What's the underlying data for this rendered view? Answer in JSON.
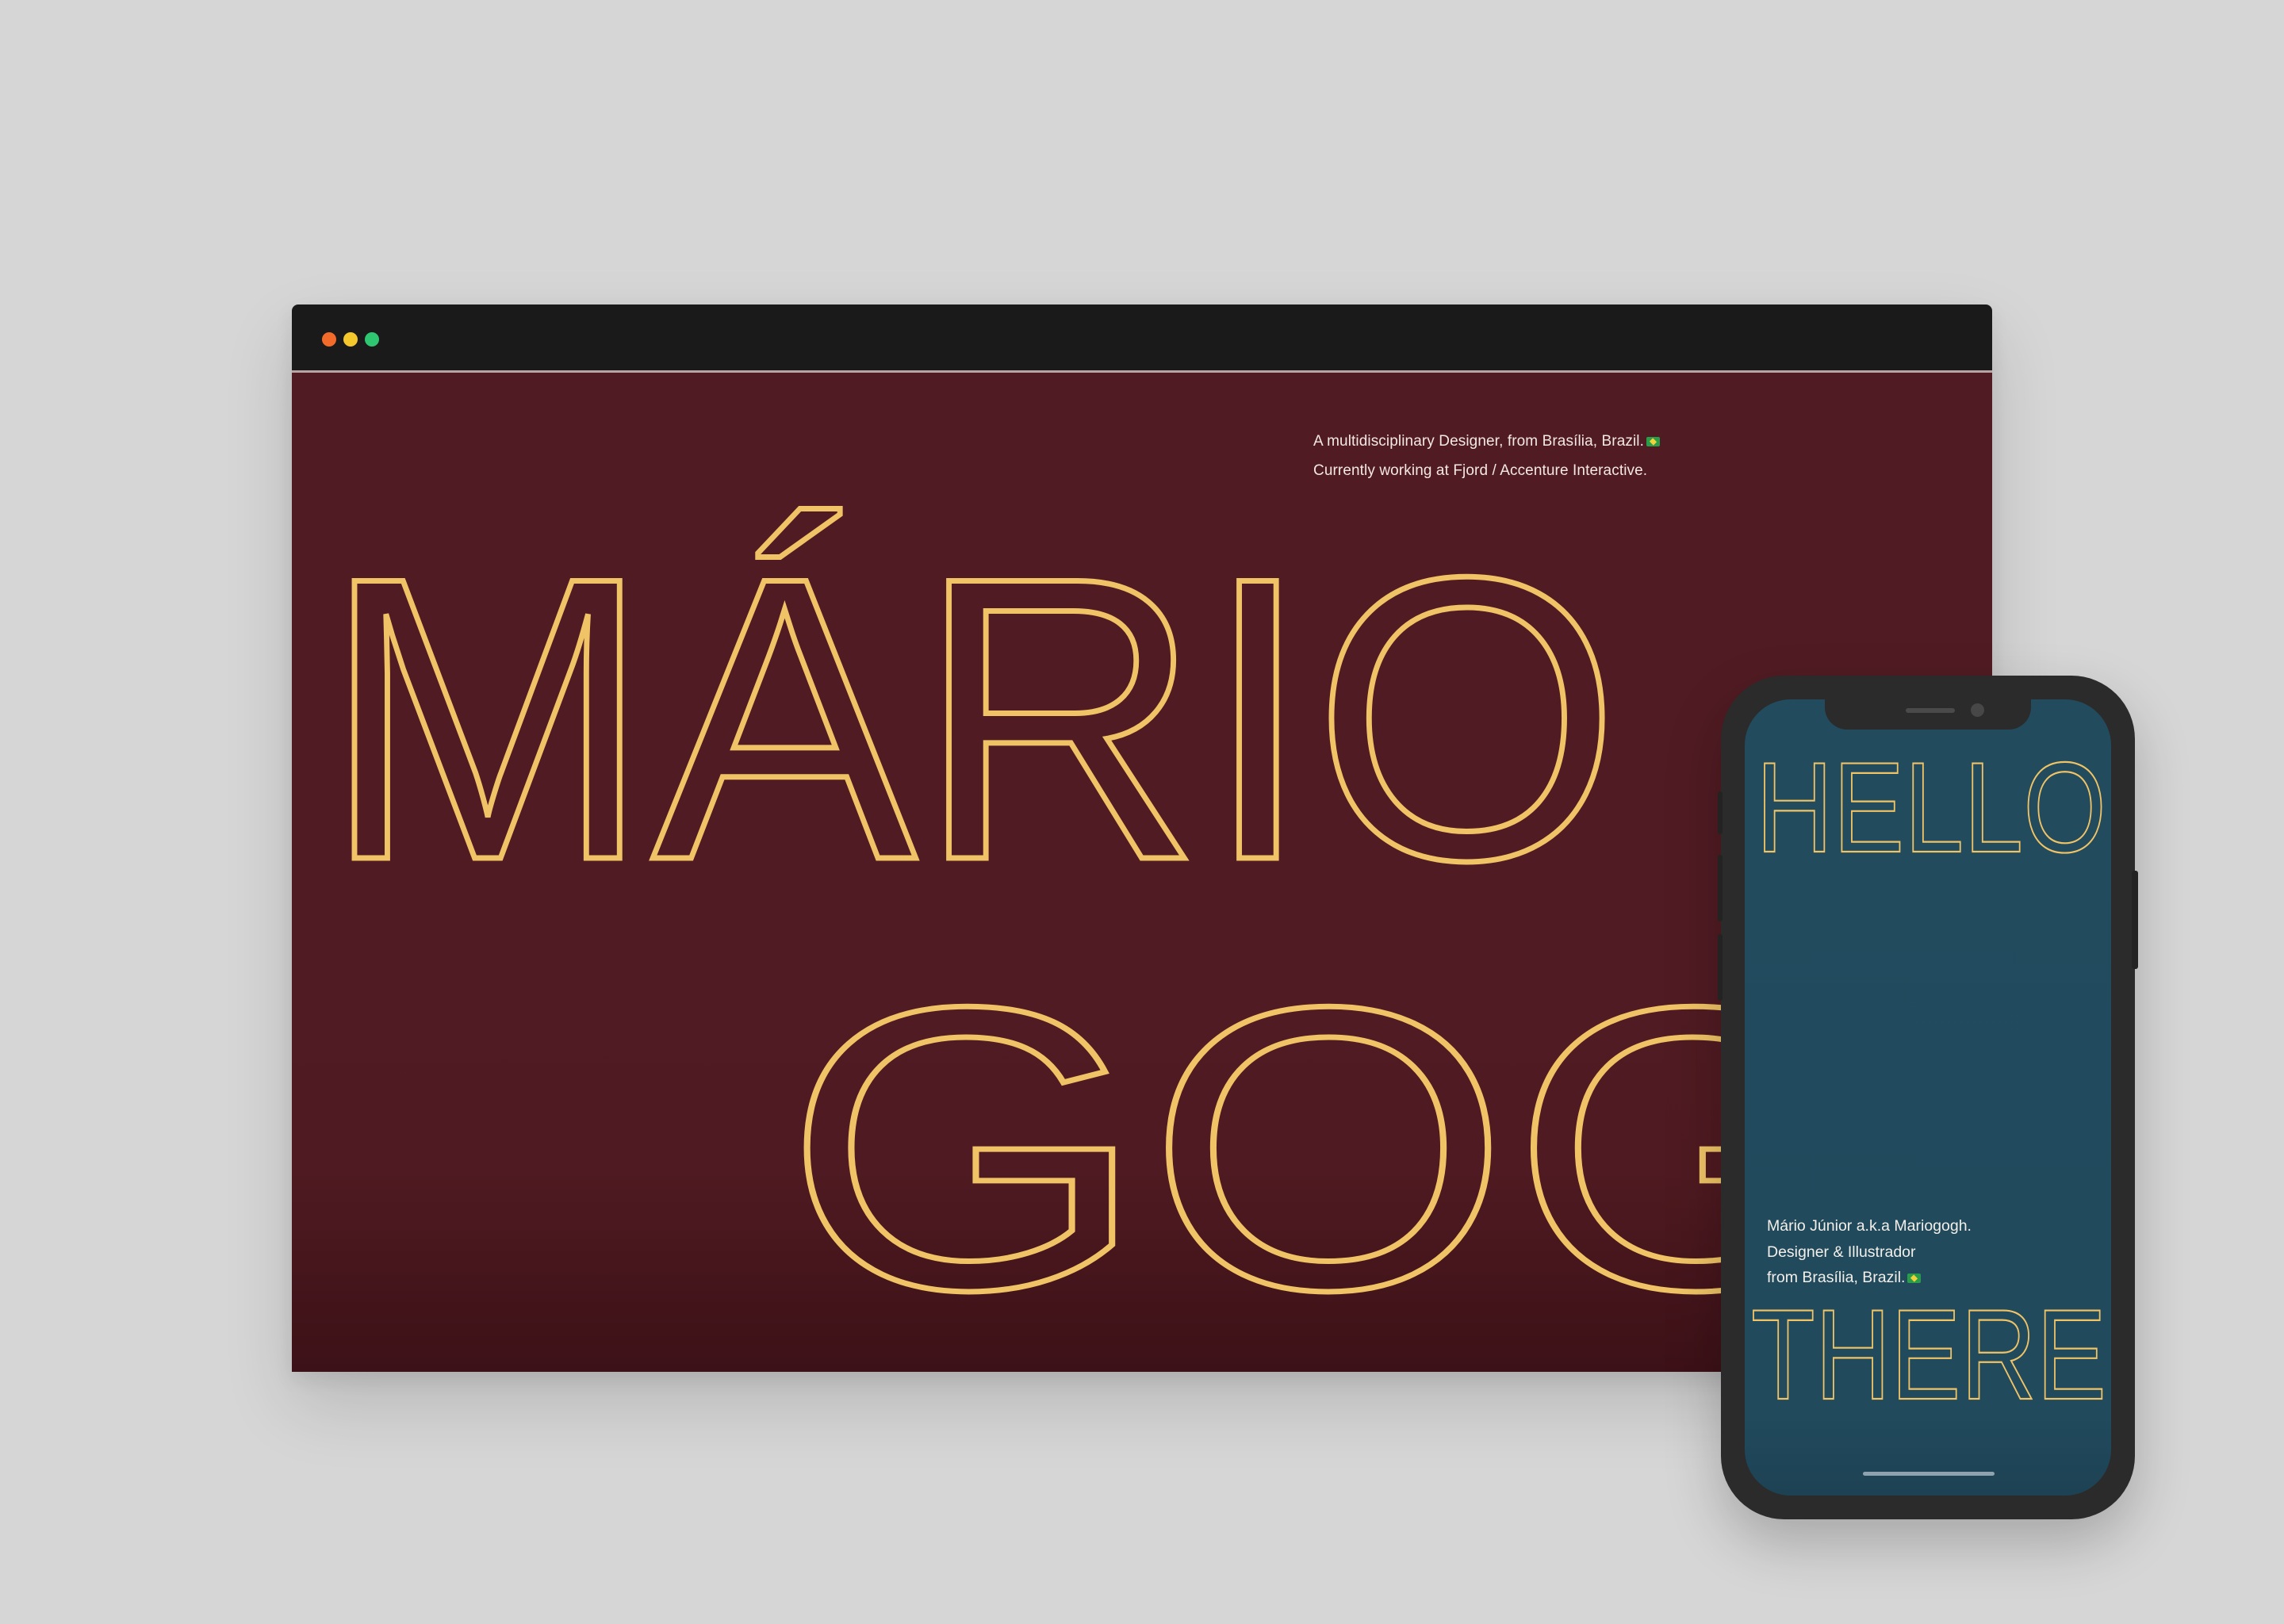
{
  "colors": {
    "background": "#d6d6d6",
    "browser_bar": "#1a1a1a",
    "desktop_page": "#511b23",
    "phone_screen": "#224b5e",
    "gold": "#f0c466",
    "dot_red": "#f36b2b",
    "dot_yellow": "#f4c82c",
    "dot_green": "#2fc672"
  },
  "desktop": {
    "window_controls": [
      "close-dot",
      "minimize-dot",
      "maximize-dot"
    ],
    "intro_line_1": "A multidisciplinary Designer, from Brasília, Brazil.",
    "intro_line_2": "Currently working at Fjord / Accenture Interactive.",
    "flag_icon": "brazil-flag-icon",
    "hero_line_1": "MÁRIO",
    "hero_line_2": "GOGH"
  },
  "mobile": {
    "headline_top": "HELLO",
    "bio_line_1": "Mário Júnior a.k.a Mariogogh.",
    "bio_line_2": "Designer & Illustrador",
    "bio_line_3": "from Brasília, Brazil.",
    "flag_icon": "brazil-flag-icon",
    "headline_bottom": "THERE"
  }
}
